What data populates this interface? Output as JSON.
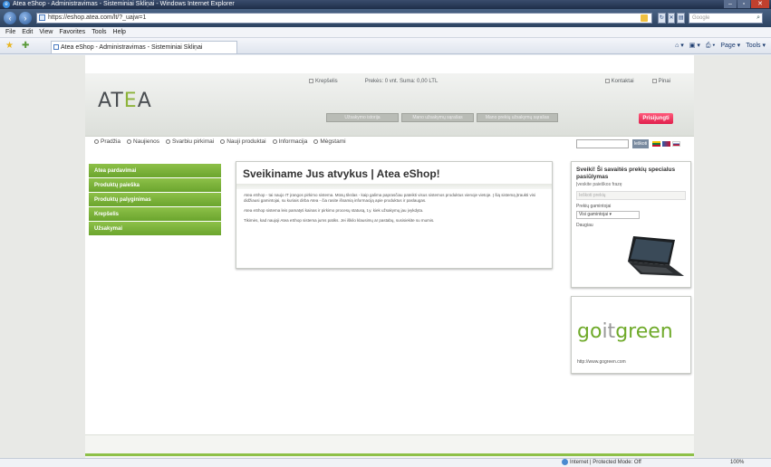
{
  "window": {
    "title": "Atea eShop - Administravimas - Sisteminiai Skliņai - Windows Internet Explorer",
    "buttons": [
      "–",
      "▫",
      "✕"
    ]
  },
  "browser": {
    "address": "https://eshop.atea.com/lt/?_uajw=1",
    "search_placeholder": "Google",
    "menu": [
      "File",
      "Edit",
      "View",
      "Favorites",
      "Tools",
      "Help"
    ],
    "tab_title": "Atea eShop - Administravimas - Sisteminiai Skliņai",
    "commands": [
      "Page ▾",
      "Tools ▾"
    ],
    "status_zone": "Internet | Protected Mode: Off",
    "zoom": "100%"
  },
  "site": {
    "logo_prefix": "AT",
    "logo_accent": "E",
    "logo_suffix": "A",
    "header_left": "Krepšelis",
    "header_middle": "Prekės: 0 vnt.  Suma: 0,00 LTL",
    "header_right": [
      "Kontaktai",
      "Pinai"
    ],
    "header_buttons": [
      "Užsakymo istorija",
      "Mano užsakymų sąrašas",
      "Mano prekių užsakymų sąrašas"
    ],
    "login": "Prisijungti",
    "subnav": [
      "Pradžia",
      "Naujienos",
      "Svarbiu pirkimai",
      "Nauji produktai",
      "Informacija",
      "Mėgstami"
    ],
    "search_button": "Ieškoti",
    "flag_colors": [
      "#c8102e",
      "#f4c300",
      "#2a5caa"
    ],
    "leftnav": [
      "Atea pardavimai",
      "Produktų paieška",
      "Produktų palyginimas",
      "Krepšelis",
      "Užsakymai"
    ],
    "welcome_title": "Sveikiname Jus atvykus | Atea eShop!",
    "welcome_paragraphs": [
      "Atea eShop - tai naujo IT įrangos pirkimo sistema. Mūsų tikslas - kaip galima paprasčiau pateikti visus sistemos produktus vienoje vietoje. Į šią sistemą įtraukti visi didžiausi gamintojai, su kuriais dirba Atea - čia rasite išsamią informaciją apie produktus ir paslaugas.",
      "Atea eShop sistema leis pamatyti kainas ir pirkimo procesų statusą, t.y. kiek užsakymų jau įvykdyta.",
      "Tikimės, kad naujoji Atea eShop sistema jums patiks. Jei iškilo klausimų ar pastabų, susisiekite su mumis."
    ],
    "right_box_title": "Sveiki! Ši savaitės prekių specialus pasiūlymas",
    "right_box_subtitle": "Įveskite paieškos frazę",
    "right_box_field": "Ieškoti prekių",
    "right_box_label": "Prekių gamintojai",
    "right_box_select": "Visi gamintojai ▾",
    "right_box_more": "Daugiau",
    "gogreen_left": "go",
    "gogreen_mid": "it",
    "gogreen_right": "green",
    "gogreen_link": "http://www.gogreen.com"
  }
}
